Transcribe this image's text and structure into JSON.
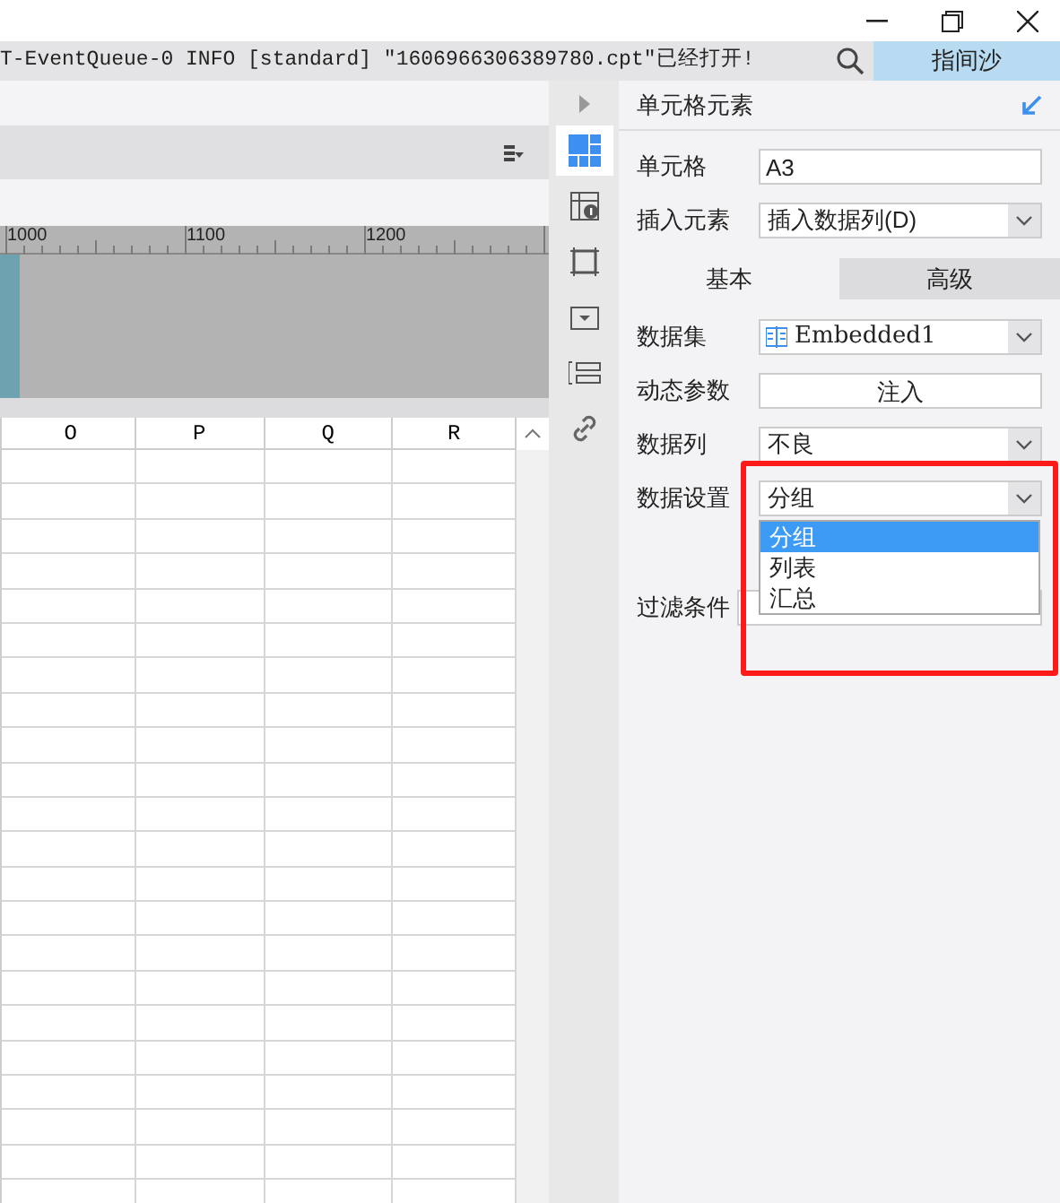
{
  "log_bar": {
    "message": "T-EventQueue-0 INFO [standard] \"1606966306389780.cpt\"已经打开!",
    "user_button": "指间沙"
  },
  "ruler": {
    "labels": [
      "1000",
      "1100",
      "1200"
    ]
  },
  "sheet": {
    "columns": [
      "O",
      "P",
      "Q",
      "R"
    ]
  },
  "side_tabs": [
    {
      "kind": "cell",
      "selected": true
    },
    {
      "kind": "attr",
      "selected": false
    },
    {
      "kind": "frame",
      "selected": false
    },
    {
      "kind": "widget",
      "selected": false
    },
    {
      "kind": "list",
      "selected": false
    },
    {
      "kind": "link",
      "selected": false
    }
  ],
  "panel": {
    "title": "单元格元素",
    "top_fields": [
      {
        "label": "单元格",
        "kind": "input",
        "value": "A3"
      },
      {
        "label": "插入元素",
        "kind": "select",
        "value": "插入数据列(D)"
      }
    ],
    "tabs": [
      {
        "label": "基本",
        "selected": true
      },
      {
        "label": "高级",
        "selected": false
      }
    ],
    "fields": [
      {
        "label": "数据集",
        "kind": "dataset",
        "value": "Embedded1"
      },
      {
        "label": "动态参数",
        "kind": "button",
        "value": "注入"
      },
      {
        "label": "数据列",
        "kind": "select",
        "value": "不良"
      },
      {
        "label": "数据设置",
        "kind": "select",
        "value": "分组"
      }
    ],
    "dropdown_options": [
      {
        "label": "分组",
        "selected": true
      },
      {
        "label": "列表",
        "selected": false
      },
      {
        "label": "汇总",
        "selected": false
      }
    ],
    "filter": {
      "label": "过滤条件"
    }
  }
}
